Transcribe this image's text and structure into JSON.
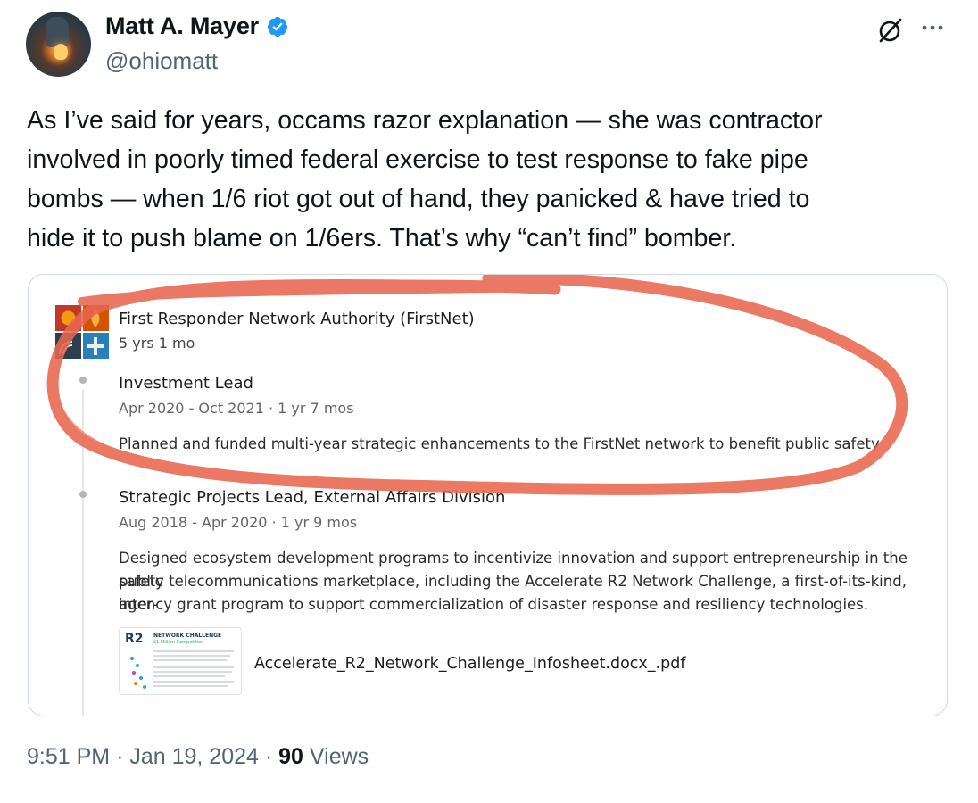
{
  "author": {
    "name": "Matt A. Mayer",
    "handle": "@ohiomatt",
    "verified_color": "#1d9bf0"
  },
  "icons": {
    "verified": "verified-badge-icon",
    "grok": "grok-icon",
    "more": "more-icon"
  },
  "tweet": {
    "text": "As I’ve said for years, occams razor explanation — she was contractor\ninvolved in poorly timed federal exercise to test response to fake pipe\nbombs — when 1/6 riot got out of hand, they panicked & have tried to\nhide it to push blame on 1/6ers. That’s why “can’t find” bomber."
  },
  "attachment": {
    "org_name": "First Responder Network Authority (FirstNet)",
    "org_duration": "5 yrs 1 mo",
    "highlight_color": "#e8664f",
    "positions": [
      {
        "title": "Investment Lead",
        "dates": "Apr 2020 - Oct 2021 · 1 yr 7 mos",
        "description": "Planned and funded multi-year strategic enhancements to the FirstNet network to benefit public safety"
      },
      {
        "title": "Strategic Projects Lead, External Affairs Division",
        "dates": "Aug 2018 - Apr 2020 · 1 yr 9 mos",
        "description_lines": [
          "Designed ecosystem development programs to incentivize innovation and support entrepreneurship in the public",
          "safety telecommunications marketplace, including the Accelerate R2 Network Challenge, a first-of-its-kind, inter-",
          "agency grant program to support commercialization of disaster response and resiliency technologies."
        ]
      }
    ],
    "document": {
      "thumb_logo": "R2",
      "thumb_heading": "NETWORK CHALLENGE",
      "thumb_subheading": "$1 Million Competition",
      "file_name": "Accelerate_R2_Network_Challenge_Infosheet.docx_.pdf"
    }
  },
  "meta": {
    "time": "9:51 PM",
    "separator": "·",
    "date": "Jan 19, 2024",
    "views_count": "90",
    "views_label": "Views"
  }
}
